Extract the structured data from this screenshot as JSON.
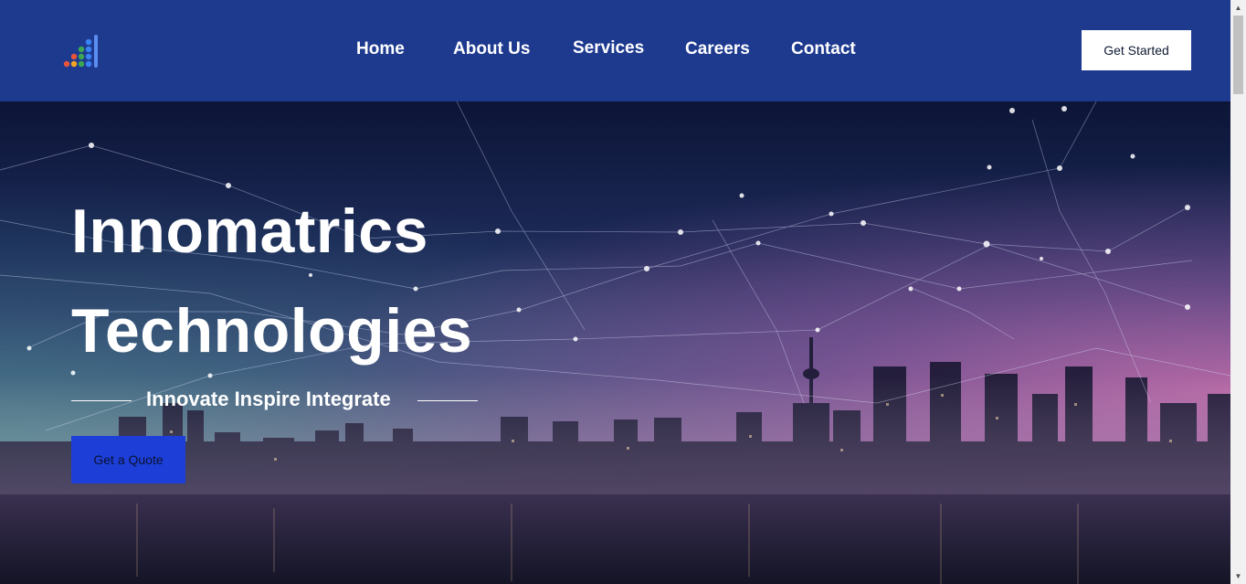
{
  "nav": {
    "logo_icon": "bar-chart-dots-logo",
    "links": [
      "Home",
      "About Us",
      "Services",
      "Careers",
      "Contact"
    ],
    "cta_label": "Get Started"
  },
  "hero": {
    "title_line1": "Innomatrics",
    "title_line2": "Technologies",
    "tagline": "Innovate Inspire Integrate",
    "button_label": "Get a Quote"
  },
  "colors": {
    "nav_bg": "#1e3a8f",
    "cta_bg": "#ffffff",
    "quote_button_bg": "#1d3fd8",
    "text": "#ffffff"
  },
  "scrollbar": {
    "up_icon": "triangle-up-icon",
    "down_icon": "triangle-down-icon"
  }
}
